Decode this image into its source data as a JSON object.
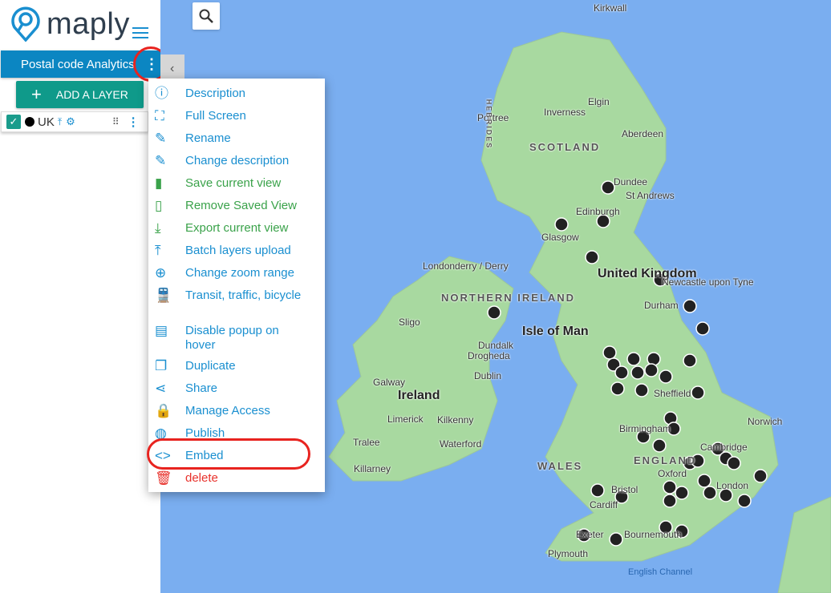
{
  "app": {
    "name": "maply"
  },
  "sidebar": {
    "project_title": "Postal code Analytics",
    "add_layer_label": "ADD A LAYER",
    "layer": {
      "name": "UK",
      "checked": true,
      "color": "#000000"
    },
    "collapse_icon": "chevron-left-icon"
  },
  "menu": {
    "items": [
      {
        "label": "Description",
        "icon": "info-icon",
        "color": "#1a8fd0"
      },
      {
        "label": "Full Screen",
        "icon": "fullscreen-icon",
        "color": "#1a8fd0"
      },
      {
        "label": "Rename",
        "icon": "pencil-icon",
        "color": "#1a8fd0"
      },
      {
        "label": "Change description",
        "icon": "pencil-icon",
        "color": "#1a8fd0"
      },
      {
        "label": "Save current view",
        "icon": "bookmark-filled-icon",
        "color": "#3aa24a"
      },
      {
        "label": "Remove Saved View",
        "icon": "bookmark-outline-icon",
        "color": "#3aa24a"
      },
      {
        "label": "Export current view",
        "icon": "download-icon",
        "color": "#3aa24a"
      },
      {
        "label": "Batch layers upload",
        "icon": "upload-icon",
        "color": "#1a8fd0"
      },
      {
        "label": "Change zoom range",
        "icon": "zoom-in-icon",
        "color": "#1a8fd0"
      },
      {
        "label": "Transit, traffic, bicycle",
        "icon": "train-icon",
        "color": "#1a8fd0"
      },
      {
        "label": "Disable popup on hover",
        "icon": "comment-icon",
        "color": "#1a8fd0"
      },
      {
        "label": "Duplicate",
        "icon": "copy-icon",
        "color": "#1a8fd0"
      },
      {
        "label": "Share",
        "icon": "share-icon",
        "color": "#1a8fd0"
      },
      {
        "label": "Manage Access",
        "icon": "lock-icon",
        "color": "#1a8fd0"
      },
      {
        "label": "Publish",
        "icon": "globe-icon",
        "color": "#1a8fd0"
      },
      {
        "label": "Embed",
        "icon": "code-icon",
        "color": "#1a8fd0"
      },
      {
        "label": "delete",
        "icon": "trash-icon",
        "color": "#e8322c"
      }
    ]
  },
  "map": {
    "labels": {
      "kirkwall": "Kirkwall",
      "elgin": "Elgin",
      "inverness": "Inverness",
      "aberdeen": "Aberdeen",
      "portree": "Portree",
      "scotland": "SCOTLAND",
      "hebrides": "HEBRIDES",
      "dundee": "Dundee",
      "standrews": "St Andrews",
      "edinburgh": "Edinburgh",
      "glasgow": "Glasgow",
      "londonderry": "Londonderry / Derry",
      "northern_ireland": "NORTHERN IRELAND",
      "uk": "United Kingdom",
      "newcastle": "Newcastle upon Tyne",
      "durham": "Durham",
      "sligo": "Sligo",
      "isle_of_man": "Isle of Man",
      "dundalk": "Dundalk",
      "drogheda": "Drogheda",
      "dublin": "Dublin",
      "galway": "Galway",
      "ireland": "Ireland",
      "limerick": "Limerick",
      "kilkenny": "Kilkenny",
      "tralee": "Tralee",
      "killarney": "Killarney",
      "waterford": "Waterford",
      "sheffield": "Sheffield",
      "norwich": "Norwich",
      "birmingham": "Birmingham",
      "cambridge": "Cambridge",
      "england": "ENGLAND",
      "wales": "WALES",
      "oxford": "Oxford",
      "bristol": "Bristol",
      "cardiff": "Cardiff",
      "london": "London",
      "exeter": "Exeter",
      "bournemouth": "Bournemouth",
      "plymouth": "Plymouth",
      "english_channel": "English Channel"
    }
  }
}
